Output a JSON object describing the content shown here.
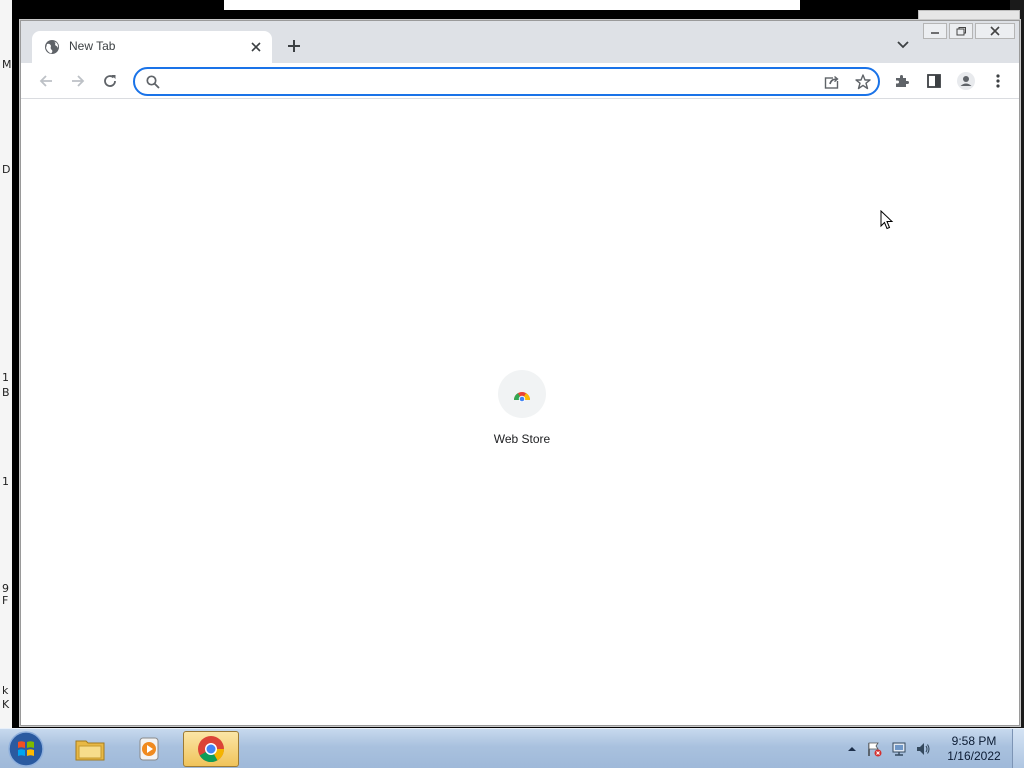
{
  "desktop": {
    "left_fragments": [
      "M",
      "D",
      "1",
      "B",
      "1",
      "9",
      "F",
      "k",
      "K"
    ]
  },
  "browser": {
    "tab": {
      "title": "New Tab"
    },
    "omnibox": {
      "value": "",
      "placeholder": ""
    },
    "shortcuts": [
      {
        "label": "Web Store"
      }
    ]
  },
  "taskbar": {
    "clock": {
      "time": "9:58 PM",
      "date": "1/16/2022"
    }
  },
  "colors": {
    "accent": "#1a73e8",
    "tabstrip": "#dee1e6",
    "taskbar": "#a9c1de"
  }
}
